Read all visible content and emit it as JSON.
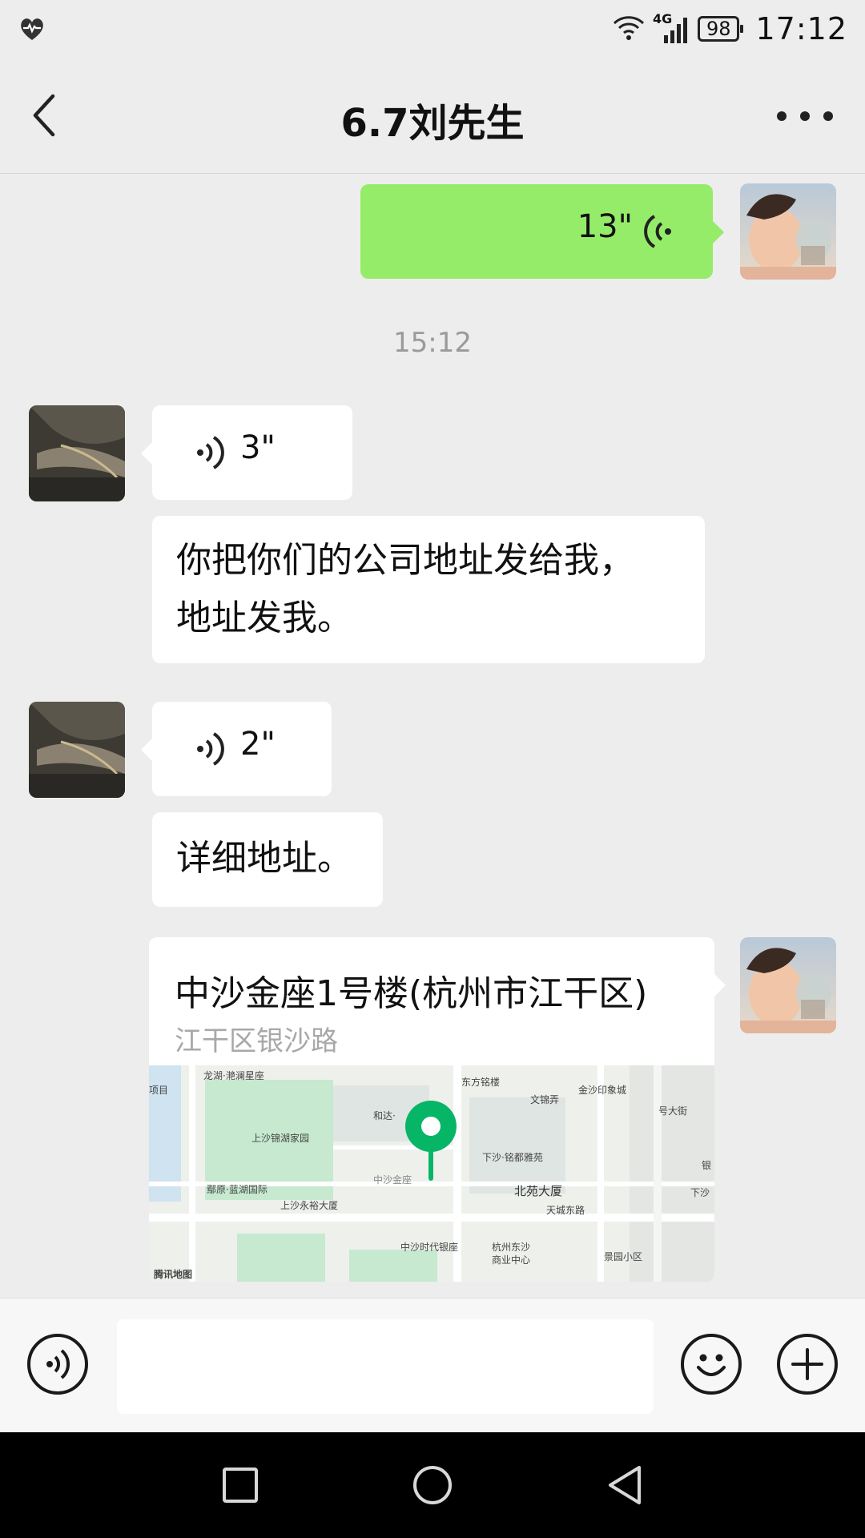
{
  "status_bar": {
    "network": "4G",
    "battery": "98",
    "time": "17:12"
  },
  "header": {
    "title": "6.7刘先生"
  },
  "messages": {
    "sent_voice": {
      "duration": "13\""
    },
    "timestamp": "15:12",
    "voice_1": {
      "duration": "3\""
    },
    "text_1": {
      "line1": "你把你们的公司地址发给我，",
      "line2": "地址发我。"
    },
    "voice_2": {
      "duration": "2\""
    },
    "text_2": "详细地址。",
    "location": {
      "title": "中沙金座1号楼(杭州市江干区)",
      "address": "江干区银沙路",
      "map_labels": [
        "龙湖·滟澜星座",
        "东方铭楼",
        "金沙印象城",
        "文锦弄",
        "和达·",
        "上沙锦湖家园",
        "下沙·铭都雅苑",
        "中沙金座",
        "北苑大厦",
        "鄢原·蓝湖国际",
        "上沙永裕大厦",
        "天城东路",
        "中沙时代银座",
        "杭州东沙",
        "商业中心",
        "景园小区",
        "号大街",
        "下沙",
        "银",
        "腾讯地图",
        "项目"
      ]
    }
  },
  "input": {
    "placeholder": ""
  },
  "colors": {
    "sent_bubble": "#95ec69",
    "background": "#ededed",
    "pin": "#07b566"
  }
}
